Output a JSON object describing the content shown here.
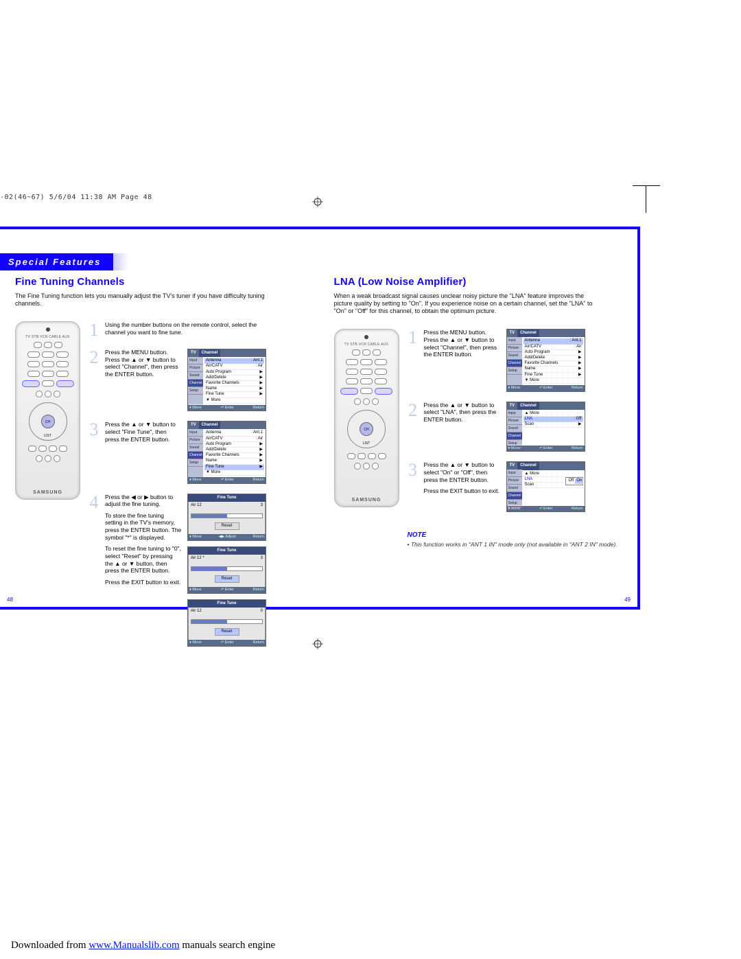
{
  "meta": {
    "pageinfo": "-02(46~67)  5/6/04  11:38 AM  Page 48"
  },
  "section_tab": "Special Features",
  "left": {
    "title": "Fine Tuning Channels",
    "intro": "The Fine Tuning function lets you manually adjust the TV's tuner if you have difficulty tuning channels.",
    "steps": [
      {
        "n": "1",
        "text": "Using the number buttons on the remote control, select the channel you want to fine tune."
      },
      {
        "n": "2",
        "text": "Press the MENU button. Press the ▲ or ▼ button to select \"Channel\", then press the ENTER button."
      },
      {
        "n": "3",
        "text": "Press the ▲ or ▼ button to select \"Fine Tune\", then press the ENTER button."
      },
      {
        "n": "4",
        "text": "Press the ◀ or ▶ button to adjust the fine tuning."
      }
    ],
    "extra": [
      "To store the fine tuning setting in the TV's memory, press the ENTER button. The symbol \"*\" is displayed.",
      "To reset the fine tuning to \"0\", select \"Reset\" by pressing the ▲ or ▼ button, then press the ENTER button.",
      "Press the EXIT button to exit."
    ],
    "page": "48"
  },
  "right": {
    "title": "LNA (Low Noise Amplifier)",
    "intro": "When a weak broadcast signal causes unclear noisy picture the \"LNA\" feature improves the picture quality by setting to \"On\". If you experience noise on a certain channel, set the \"LNA\" to \"On\" or \"Off\" for this channel, to obtain the optimum picture.",
    "steps": [
      {
        "n": "1",
        "text": "Press the MENU button. Press the ▲ or ▼ button to select \"Channel\", then press the ENTER button."
      },
      {
        "n": "2",
        "text": "Press the ▲ or ▼ button to select \"LNA\", then press the ENTER button."
      },
      {
        "n": "3",
        "text": "Press the ▲ or ▼ button to select \"On\" or \"Off\", then press the ENTER button."
      }
    ],
    "extra": [
      "Press the EXIT button to exit."
    ],
    "note_h": "NOTE",
    "note": "• This function works in \"ANT 1 IN\" mode only (not available in \"ANT 2 IN\" mode).",
    "page": "49"
  },
  "osd": {
    "tabs": {
      "tv": "TV",
      "ch": "Channel"
    },
    "side": [
      "Input",
      "Picture",
      "Sound",
      "Channel",
      "Setup"
    ],
    "menu_full": [
      {
        "k": "Antenna",
        "v": ": Ant.1",
        "a": true
      },
      {
        "k": "Air/CATV",
        "v": ": Air",
        "a": true
      },
      {
        "k": "Auto Program",
        "v": "",
        "a": true
      },
      {
        "k": "Add/Delete",
        "v": "",
        "a": true
      },
      {
        "k": "Favorite Channels",
        "v": "",
        "a": true
      },
      {
        "k": "Name",
        "v": "",
        "a": true
      },
      {
        "k": "Fine Tune",
        "v": "",
        "a": true
      },
      {
        "k": "▼ More",
        "v": "",
        "a": false
      }
    ],
    "menu_p2": [
      {
        "k": "▲ More",
        "v": "",
        "a": false
      },
      {
        "k": "LNA",
        "v": ": Off",
        "a": true,
        "sel": true
      },
      {
        "k": "Scan",
        "v": "",
        "a": true
      }
    ],
    "menu_lna_opt": [
      {
        "k": "▲ More",
        "v": "",
        "a": false
      },
      {
        "k": "LNA",
        "v": "",
        "a": false,
        "sel": true
      },
      {
        "k": "Scan",
        "v": "",
        "a": false
      }
    ],
    "lna_opts": {
      "off": "Off",
      "on": "On"
    },
    "foot": {
      "move": "Move",
      "enter": "Enter",
      "return": "Return",
      "adjust": "Adjust"
    },
    "ft": {
      "title": "Fine Tune",
      "ch": "Air 12",
      "chstar": "Air 12 *",
      "val": "3",
      "val0": "0",
      "reset": "Reset"
    }
  },
  "remote": {
    "brand": "SAMSUNG",
    "labels": "TV  STB  VCR  CABLE  AUX",
    "center": "CH LIST"
  },
  "download": {
    "pre": "Downloaded from ",
    "link": "www.Manualslib.com",
    "post": " manuals search engine"
  }
}
